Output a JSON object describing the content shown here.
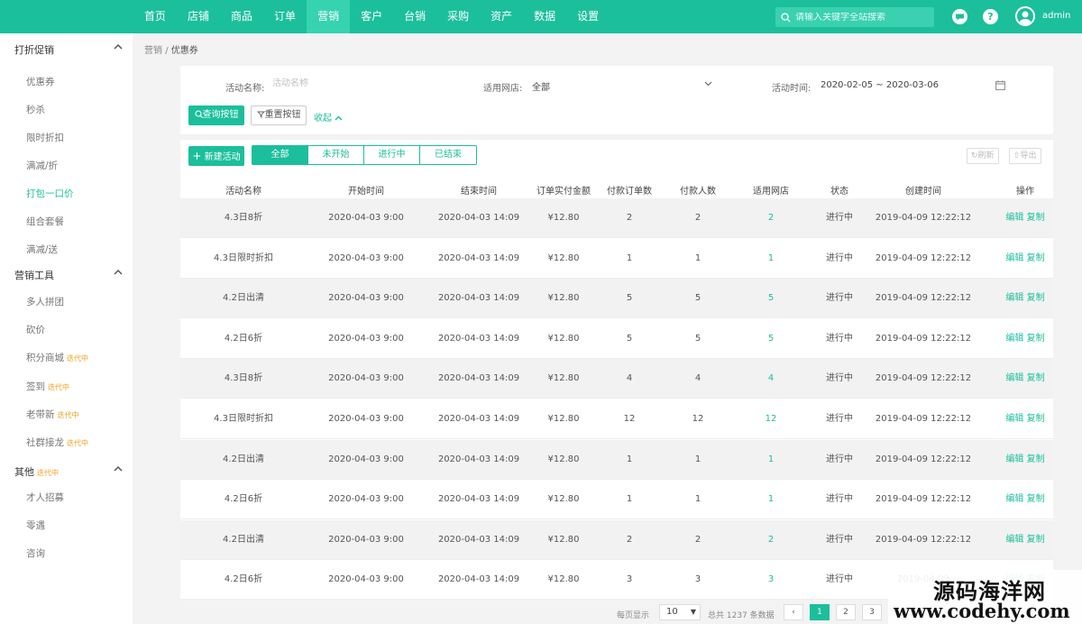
{
  "colors": {
    "brand": "#1bbf9c",
    "nav_active": "#36d3b0",
    "badge": "#f0a020"
  },
  "nav": {
    "items": [
      "首页",
      "店铺",
      "商品",
      "订单",
      "营销",
      "客户",
      "台销",
      "采购",
      "资产",
      "数据",
      "设置"
    ],
    "active_index": 4
  },
  "search": {
    "placeholder": "请输入关键字全站搜索"
  },
  "user": {
    "name": "admin"
  },
  "sidebar": {
    "groups": [
      {
        "label": "打折促销",
        "badge": "",
        "icon": "chevron-up-icon",
        "items": [
          {
            "label": "优惠券",
            "badge": ""
          },
          {
            "label": "秒杀",
            "badge": ""
          },
          {
            "label": "限时折扣",
            "badge": ""
          },
          {
            "label": "满减/折",
            "badge": ""
          },
          {
            "label": "打包一口价",
            "badge": ""
          },
          {
            "label": "组合套餐",
            "badge": ""
          },
          {
            "label": "满减/送",
            "badge": ""
          }
        ]
      },
      {
        "label": "营销工具",
        "badge": "",
        "icon": "chevron-up-icon",
        "items": [
          {
            "label": "多人拼团",
            "badge": ""
          },
          {
            "label": "砍价",
            "badge": ""
          },
          {
            "label": "积分商城",
            "badge": "迭代中"
          },
          {
            "label": "签到",
            "badge": "迭代中"
          },
          {
            "label": "老带新",
            "badge": "迭代中"
          },
          {
            "label": "社群接龙",
            "badge": "迭代中"
          }
        ]
      },
      {
        "label": "其他",
        "badge": "迭代中",
        "icon": "chevron-up-icon",
        "items": [
          {
            "label": "才人招募",
            "badge": ""
          },
          {
            "label": "零遇",
            "badge": ""
          },
          {
            "label": "咨询",
            "badge": ""
          }
        ]
      }
    ],
    "active_item": "打包一口价"
  },
  "breadcrumb": {
    "parent": "营销",
    "sep": "/",
    "current": "优惠券"
  },
  "filter": {
    "name_label": "活动名称:",
    "name_placeholder": "活动名称",
    "store_label": "适用网店:",
    "store_value": "全部",
    "time_label": "活动时间:",
    "time_value": "2020-02-05 ~ 2020-03-06",
    "query_button": "查询按钮",
    "reset_button": "重置按钮",
    "collapse": "收起"
  },
  "toolbar": {
    "new_button": "新建活动",
    "tabs": [
      "全部",
      "未开始",
      "进行中",
      "已结束"
    ],
    "active_tab": 0,
    "refresh": "刷新",
    "export": "导出"
  },
  "table": {
    "columns": [
      "活动名称",
      "开始时间",
      "结束时间",
      "订单实付金额",
      "付款订单数",
      "付款人数",
      "适用网店",
      "状态",
      "创建时间",
      "操作"
    ],
    "edit_label": "编辑",
    "copy_label": "复制",
    "rows": [
      {
        "name": "4.3日8折",
        "start": "2020-04-03 9:00",
        "end": "2020-04-03 14:09",
        "amount": "¥12.80",
        "orders": "2",
        "payers": "2",
        "stores": "2",
        "status": "进行中",
        "created": "2019-04-09 12:22:12"
      },
      {
        "name": "4.3日限时折扣",
        "start": "2020-04-03 9:00",
        "end": "2020-04-03 14:09",
        "amount": "¥12.80",
        "orders": "1",
        "payers": "1",
        "stores": "1",
        "status": "进行中",
        "created": "2019-04-09 12:22:12"
      },
      {
        "name": "4.2日出清",
        "start": "2020-04-03 9:00",
        "end": "2020-04-03 14:09",
        "amount": "¥12.80",
        "orders": "5",
        "payers": "5",
        "stores": "5",
        "status": "进行中",
        "created": "2019-04-09 12:22:12"
      },
      {
        "name": "4.2日6折",
        "start": "2020-04-03 9:00",
        "end": "2020-04-03 14:09",
        "amount": "¥12.80",
        "orders": "5",
        "payers": "5",
        "stores": "5",
        "status": "进行中",
        "created": "2019-04-09 12:22:12"
      },
      {
        "name": "4.3日8折",
        "start": "2020-04-03 9:00",
        "end": "2020-04-03 14:09",
        "amount": "¥12.80",
        "orders": "4",
        "payers": "4",
        "stores": "4",
        "status": "进行中",
        "created": "2019-04-09 12:22:12"
      },
      {
        "name": "4.3日限时折扣",
        "start": "2020-04-03 9:00",
        "end": "2020-04-03 14:09",
        "amount": "¥12.80",
        "orders": "12",
        "payers": "12",
        "stores": "12",
        "status": "进行中",
        "created": "2019-04-09 12:22:12"
      },
      {
        "name": "4.2日出清",
        "start": "2020-04-03 9:00",
        "end": "2020-04-03 14:09",
        "amount": "¥12.80",
        "orders": "1",
        "payers": "1",
        "stores": "1",
        "status": "进行中",
        "created": "2019-04-09 12:22:12"
      },
      {
        "name": "4.2日6折",
        "start": "2020-04-03 9:00",
        "end": "2020-04-03 14:09",
        "amount": "¥12.80",
        "orders": "1",
        "payers": "1",
        "stores": "1",
        "status": "进行中",
        "created": "2019-04-09 12:22:12"
      },
      {
        "name": "4.2日出清",
        "start": "2020-04-03 9:00",
        "end": "2020-04-03 14:09",
        "amount": "¥12.80",
        "orders": "2",
        "payers": "2",
        "stores": "2",
        "status": "进行中",
        "created": "2019-04-09 12:22:12"
      },
      {
        "name": "4.2日6折",
        "start": "2020-04-03 9:00",
        "end": "2020-04-03 14:09",
        "amount": "¥12.80",
        "orders": "3",
        "payers": "3",
        "stores": "3",
        "status": "进行中",
        "created": "2019-04-09"
      }
    ]
  },
  "pagination": {
    "per_page_label": "每页显示",
    "page_size": "10",
    "total_text": "总共 1237 条数据",
    "pages": [
      "1",
      "2",
      "3"
    ],
    "active_page": 0
  },
  "watermark": {
    "line1": "源码海洋网",
    "line2": "www.codehy.com"
  }
}
